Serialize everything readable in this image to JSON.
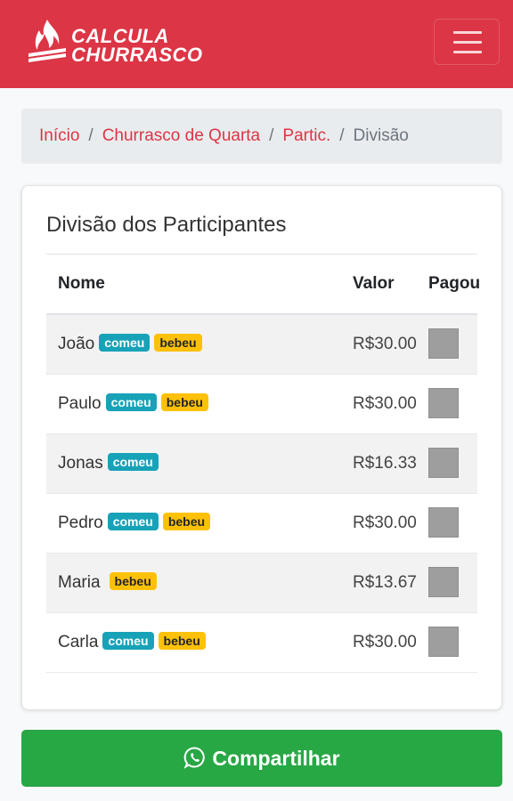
{
  "brand": {
    "line1": "CALCULA",
    "line2": "CHURRASCO",
    "logo_icon": "flame-icon"
  },
  "navbar": {
    "toggler_icon": "hamburger-icon",
    "color": "#dc3545"
  },
  "breadcrumb": {
    "items": [
      "Início",
      "Churrasco de Quarta",
      "Partic."
    ],
    "current": "Divisão",
    "separator": "/"
  },
  "card": {
    "title": "Divisão dos Participantes",
    "columns": {
      "name": "Nome",
      "value": "Valor",
      "paid": "Pagou"
    },
    "rows": [
      {
        "name": "João",
        "comeu": "comeu",
        "bebeu": "bebeu",
        "valor": "R$30.00",
        "paid": false
      },
      {
        "name": "Paulo",
        "comeu": "comeu",
        "bebeu": "bebeu",
        "valor": "R$30.00",
        "paid": false
      },
      {
        "name": "Jonas",
        "comeu": "comeu",
        "bebeu": null,
        "valor": "R$16.33",
        "paid": false
      },
      {
        "name": "Pedro",
        "comeu": "comeu",
        "bebeu": "bebeu",
        "valor": "R$30.00",
        "paid": false
      },
      {
        "name": "Maria",
        "comeu": null,
        "bebeu": "bebeu",
        "valor": "R$13.67",
        "paid": false
      },
      {
        "name": "Carla",
        "comeu": "comeu",
        "bebeu": "bebeu",
        "valor": "R$30.00",
        "paid": false
      }
    ]
  },
  "share": {
    "label": "Compartilhar",
    "icon": "whatsapp-icon",
    "color": "#28a745"
  }
}
